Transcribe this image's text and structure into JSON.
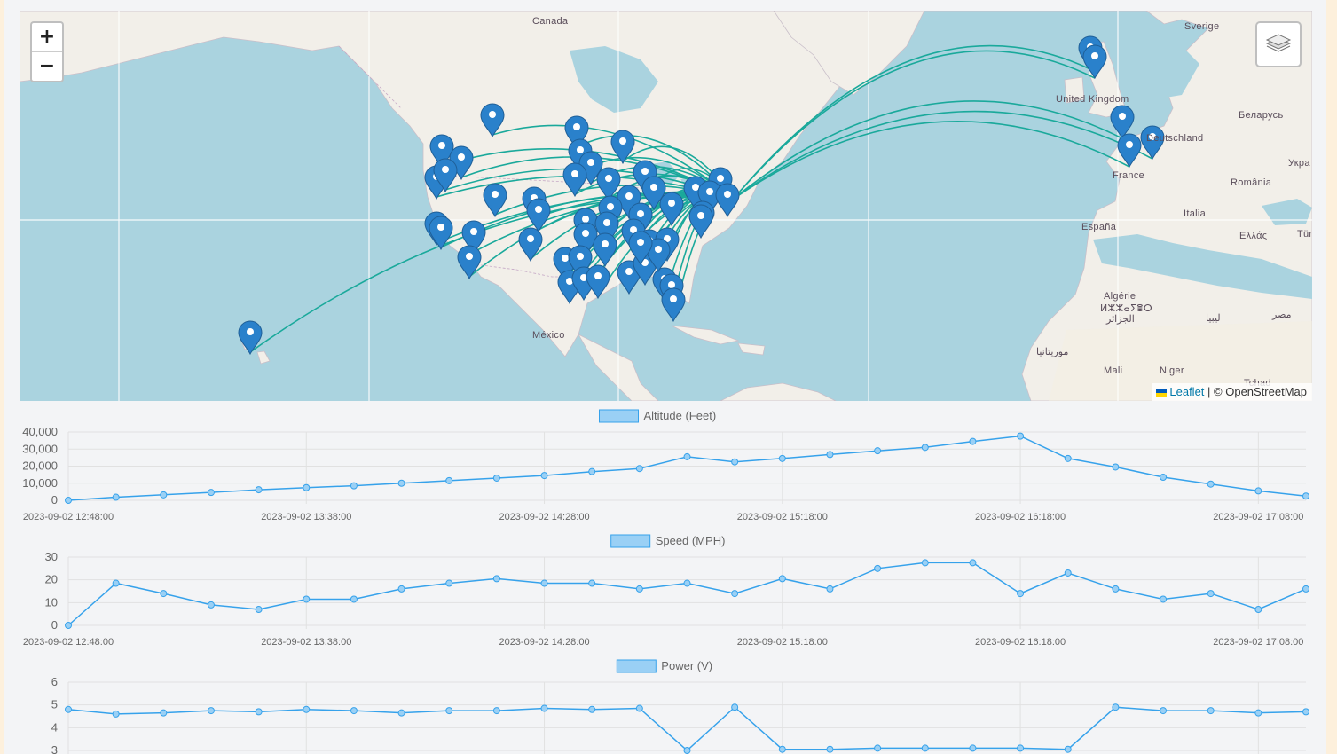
{
  "map": {
    "zoom_in_label": "+",
    "zoom_out_label": "−",
    "attribution": {
      "leaflet": "Leaflet",
      "separator": " | ",
      "osm": "© OpenStreetMap"
    },
    "labels": {
      "canada": "Canada",
      "mexico": "México",
      "sverige": "Sverige",
      "united_kingdom": "United Kingdom",
      "belarus": "Беларусь",
      "deutschland": "Deutschland",
      "france": "France",
      "romania": "România",
      "ukraine": "Укра",
      "espana": "España",
      "italia": "Italia",
      "ellas": "Ελλάς",
      "turkey": "Tür",
      "algerie": "Algérie",
      "algerie_tif": "ⵍⵣⵣⴰⵢⴻⵔ",
      "algerie_ar": "الجزائر",
      "libya": "ليبيا",
      "egypt": "مصر",
      "mauritania": "موريتانيا",
      "mali": "Mali",
      "niger": "Niger",
      "tchad": "Tchad"
    },
    "accent": "#1aa99b",
    "marker_color": "#2a81cb"
  },
  "charts": [
    {
      "legend": "Altitude (Feet)",
      "yticks": [
        "40,000",
        "30,000",
        "20,000",
        "10,000",
        "0"
      ],
      "ymax": 40000,
      "values": [
        0,
        1800,
        3200,
        4600,
        6200,
        7400,
        8500,
        10000,
        11500,
        13000,
        14500,
        16800,
        18600,
        25500,
        22500,
        24500,
        26800,
        29000,
        31000,
        34500,
        37600,
        24500,
        19500,
        13500,
        9500,
        5500,
        2500
      ],
      "xlabels": [
        "2023-09-02 12:48:00",
        "2023-09-02 13:38:00",
        "2023-09-02 14:28:00",
        "2023-09-02 15:18:00",
        "2023-09-02 16:18:00",
        "2023-09-02 17:08:00"
      ]
    },
    {
      "legend": "Speed (MPH)",
      "yticks": [
        "30",
        "20",
        "10",
        "0"
      ],
      "ymax": 30,
      "values": [
        0,
        18.5,
        14,
        9,
        7,
        11.5,
        11.5,
        16,
        18.5,
        20.5,
        18.5,
        18.5,
        16,
        18.5,
        14,
        20.5,
        16,
        25,
        27.5,
        27.5,
        14,
        23,
        16,
        11.5,
        14,
        7,
        16
      ],
      "xlabels": [
        "2023-09-02 12:48:00",
        "2023-09-02 13:38:00",
        "2023-09-02 14:28:00",
        "2023-09-02 15:18:00",
        "2023-09-02 16:18:00",
        "2023-09-02 17:08:00"
      ]
    },
    {
      "legend": "Power (V)",
      "yticks": [
        "6",
        "5",
        "4",
        "3"
      ],
      "ymax": 6,
      "ymin": 3,
      "values": [
        4.8,
        4.6,
        4.65,
        4.75,
        4.7,
        4.8,
        4.75,
        4.65,
        4.75,
        4.75,
        4.85,
        4.8,
        4.85,
        3.0,
        4.9,
        3.05,
        3.05,
        3.1,
        3.1,
        3.1,
        3.1,
        3.05,
        4.9,
        4.75,
        4.75,
        4.65,
        4.7
      ],
      "xlabels": []
    }
  ],
  "colors": {
    "line": "#36a2eb",
    "legend_fill": "#9ad0f5",
    "grid": "#e1e1e1",
    "tick": "#666666"
  }
}
